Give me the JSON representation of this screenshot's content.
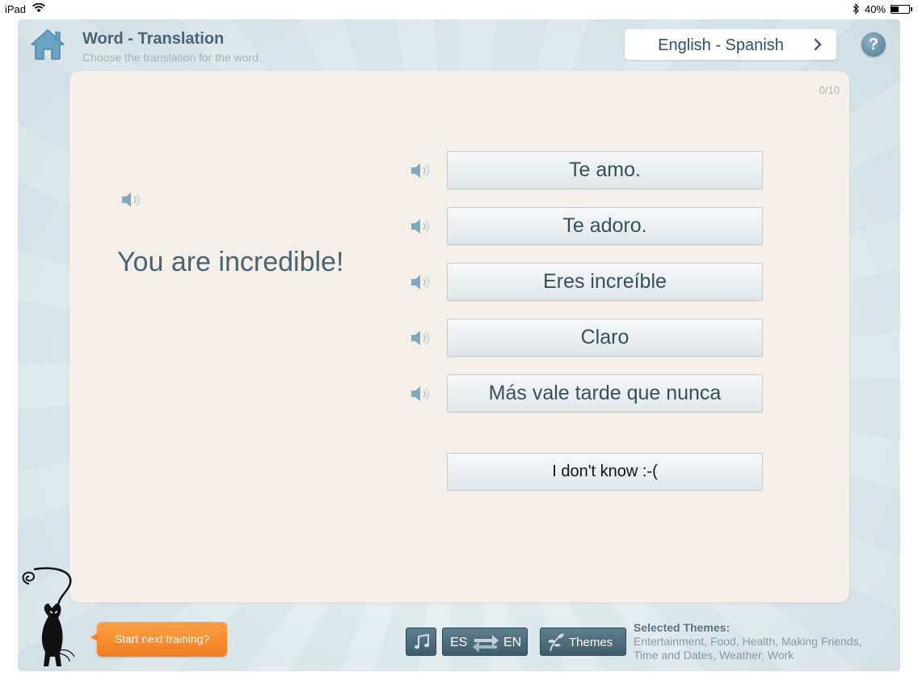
{
  "status_bar": {
    "device": "iPad",
    "battery_text": "40%",
    "battery_level": 0.4
  },
  "header": {
    "title": "Word - Translation",
    "subtitle": "Choose the translation for the word.",
    "language_pair": "English - Spanish",
    "help_label": "?"
  },
  "card": {
    "progress": "0/10",
    "word": "You are incredible!",
    "answers": [
      "Te amo.",
      "Te adoro.",
      "Eres increíble",
      "Claro",
      "Más vale tarde que nunca"
    ],
    "dont_know": "I don't know :-("
  },
  "footer": {
    "next_training": "Start next training?",
    "direction_from": "ES",
    "direction_to": "EN",
    "themes_button": "Themes",
    "selected_themes_title": "Selected Themes:",
    "selected_themes_list": "Entertainment, Food, Health, Making Friends, Time and Dates, Weather, Work"
  },
  "icons": {
    "home": "home-icon",
    "speaker": "speaker-icon",
    "help": "help-icon",
    "music": "music-note-icon",
    "swap": "swap-arrows-icon",
    "themes": "leaf-icon",
    "mascot": "cat-mascot"
  },
  "colors": {
    "accent": "#f47c1c",
    "title": "#4a6472",
    "card": "#f4efe8",
    "toolbar": "#4a6b78"
  }
}
